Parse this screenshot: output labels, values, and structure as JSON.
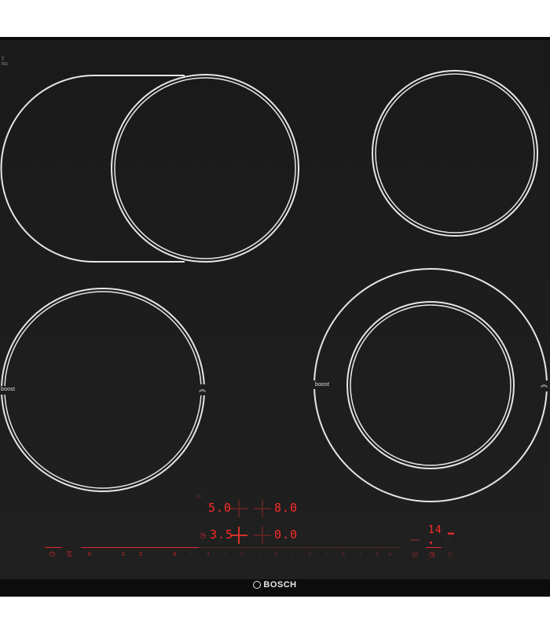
{
  "brand": {
    "name": "BOSCH"
  },
  "zones": {
    "front_left": {
      "boost_label": "boost"
    },
    "rear_right_outer": {
      "boost_label": "boost"
    }
  },
  "control_panel": {
    "displays": {
      "top_left": "5.0",
      "top_right": "8.0",
      "bottom_left": "3.5",
      "bottom_right": "0.0",
      "timer": "14"
    },
    "power_scale": [
      "0",
      "1",
      "2",
      "3",
      "4",
      "5",
      "6",
      "7",
      "8",
      "9"
    ],
    "icons": {
      "power": "power-icon",
      "child_lock": "child-lock-icon",
      "timer": "timer-icon",
      "clock": "clock-icon",
      "keep_warm": "keep-warm-icon",
      "boost": "boost-icon"
    },
    "colors": {
      "active": "#e3262b",
      "inactive": "#5a2422",
      "display": "#ff2a2a"
    }
  }
}
